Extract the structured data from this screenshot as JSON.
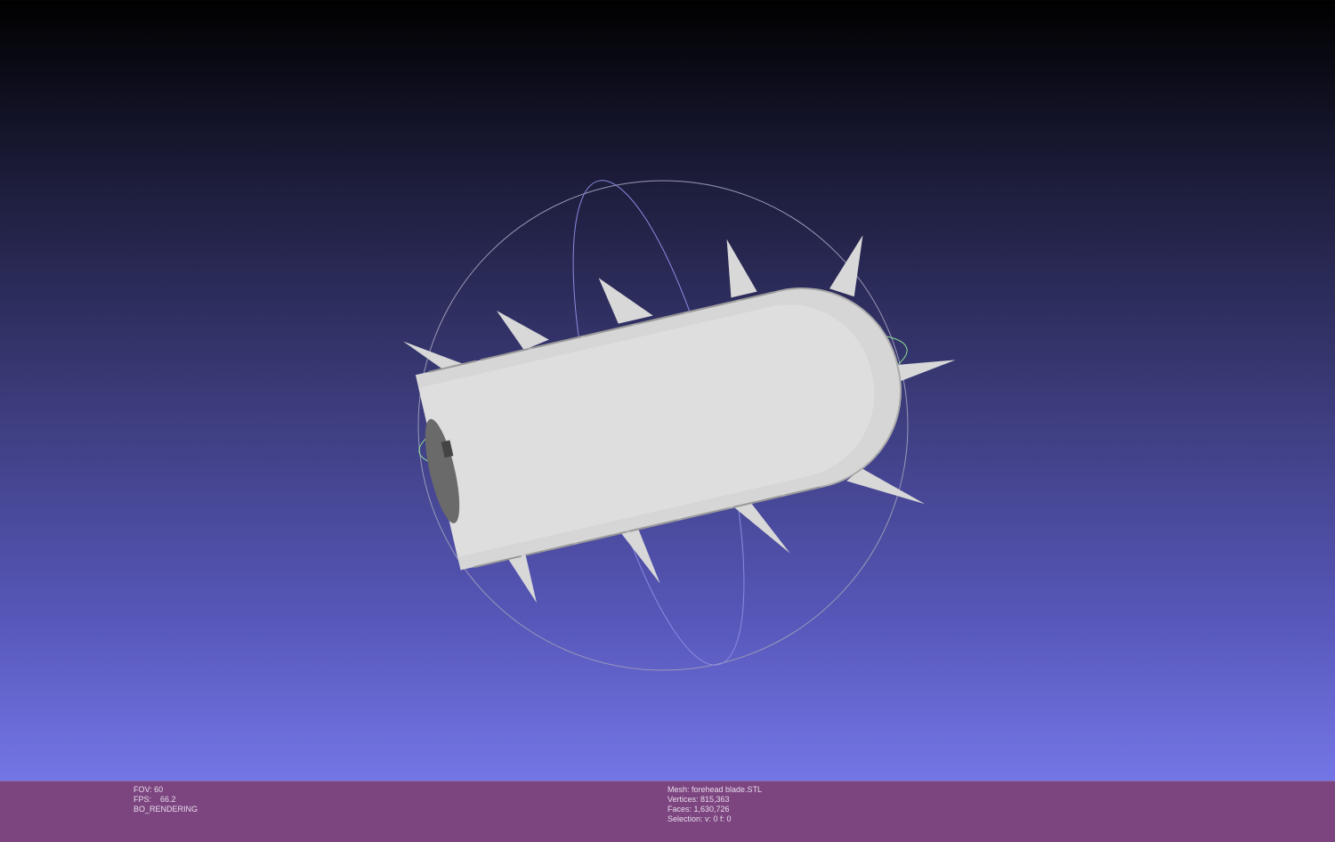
{
  "left_info": {
    "fov": "FOV: 60",
    "fps": "FPS:    66.2",
    "render_mode": "BO_RENDERING"
  },
  "mesh_info": {
    "mesh": "Mesh: forehead blade.STL",
    "vertices": "Vertices: 815,363",
    "faces": "Faces: 1,630,726",
    "selection": "Selection: v: 0 f: 0"
  },
  "colors": {
    "status_bar": "#7c4580",
    "background_bottom": "#7476e6",
    "mesh": "#dcdcdc"
  }
}
